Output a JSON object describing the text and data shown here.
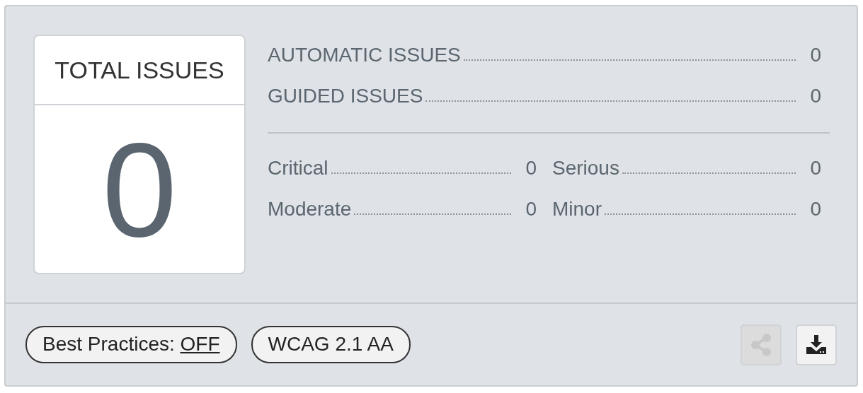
{
  "total": {
    "label": "TOTAL ISSUES",
    "count": "0"
  },
  "issue_types": [
    {
      "label": "AUTOMATIC ISSUES",
      "count": "0"
    },
    {
      "label": "GUIDED ISSUES",
      "count": "0"
    }
  ],
  "severities": [
    {
      "label": "Critical",
      "count": "0"
    },
    {
      "label": "Serious",
      "count": "0"
    },
    {
      "label": "Moderate",
      "count": "0"
    },
    {
      "label": "Minor",
      "count": "0"
    }
  ],
  "footer": {
    "best_practices": {
      "label": "Best Practices:",
      "value": "OFF"
    },
    "standard": "WCAG 2.1 AA",
    "actions": [
      {
        "kind": "share",
        "disabled": true
      },
      {
        "kind": "download",
        "disabled": false
      }
    ]
  }
}
